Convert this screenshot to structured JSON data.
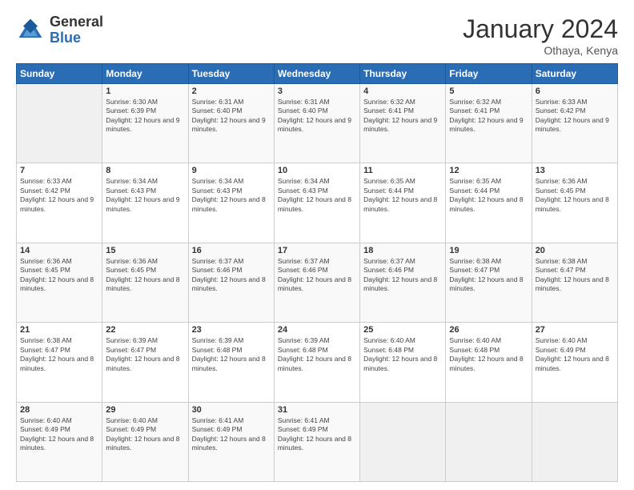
{
  "logo": {
    "general": "General",
    "blue": "Blue"
  },
  "header": {
    "month": "January 2024",
    "location": "Othaya, Kenya"
  },
  "days_of_week": [
    "Sunday",
    "Monday",
    "Tuesday",
    "Wednesday",
    "Thursday",
    "Friday",
    "Saturday"
  ],
  "weeks": [
    [
      {
        "day": "",
        "sunrise": "",
        "sunset": "",
        "daylight": ""
      },
      {
        "day": "1",
        "sunrise": "Sunrise: 6:30 AM",
        "sunset": "Sunset: 6:39 PM",
        "daylight": "Daylight: 12 hours and 9 minutes."
      },
      {
        "day": "2",
        "sunrise": "Sunrise: 6:31 AM",
        "sunset": "Sunset: 6:40 PM",
        "daylight": "Daylight: 12 hours and 9 minutes."
      },
      {
        "day": "3",
        "sunrise": "Sunrise: 6:31 AM",
        "sunset": "Sunset: 6:40 PM",
        "daylight": "Daylight: 12 hours and 9 minutes."
      },
      {
        "day": "4",
        "sunrise": "Sunrise: 6:32 AM",
        "sunset": "Sunset: 6:41 PM",
        "daylight": "Daylight: 12 hours and 9 minutes."
      },
      {
        "day": "5",
        "sunrise": "Sunrise: 6:32 AM",
        "sunset": "Sunset: 6:41 PM",
        "daylight": "Daylight: 12 hours and 9 minutes."
      },
      {
        "day": "6",
        "sunrise": "Sunrise: 6:33 AM",
        "sunset": "Sunset: 6:42 PM",
        "daylight": "Daylight: 12 hours and 9 minutes."
      }
    ],
    [
      {
        "day": "7",
        "sunrise": "Sunrise: 6:33 AM",
        "sunset": "Sunset: 6:42 PM",
        "daylight": "Daylight: 12 hours and 9 minutes."
      },
      {
        "day": "8",
        "sunrise": "Sunrise: 6:34 AM",
        "sunset": "Sunset: 6:43 PM",
        "daylight": "Daylight: 12 hours and 9 minutes."
      },
      {
        "day": "9",
        "sunrise": "Sunrise: 6:34 AM",
        "sunset": "Sunset: 6:43 PM",
        "daylight": "Daylight: 12 hours and 8 minutes."
      },
      {
        "day": "10",
        "sunrise": "Sunrise: 6:34 AM",
        "sunset": "Sunset: 6:43 PM",
        "daylight": "Daylight: 12 hours and 8 minutes."
      },
      {
        "day": "11",
        "sunrise": "Sunrise: 6:35 AM",
        "sunset": "Sunset: 6:44 PM",
        "daylight": "Daylight: 12 hours and 8 minutes."
      },
      {
        "day": "12",
        "sunrise": "Sunrise: 6:35 AM",
        "sunset": "Sunset: 6:44 PM",
        "daylight": "Daylight: 12 hours and 8 minutes."
      },
      {
        "day": "13",
        "sunrise": "Sunrise: 6:36 AM",
        "sunset": "Sunset: 6:45 PM",
        "daylight": "Daylight: 12 hours and 8 minutes."
      }
    ],
    [
      {
        "day": "14",
        "sunrise": "Sunrise: 6:36 AM",
        "sunset": "Sunset: 6:45 PM",
        "daylight": "Daylight: 12 hours and 8 minutes."
      },
      {
        "day": "15",
        "sunrise": "Sunrise: 6:36 AM",
        "sunset": "Sunset: 6:45 PM",
        "daylight": "Daylight: 12 hours and 8 minutes."
      },
      {
        "day": "16",
        "sunrise": "Sunrise: 6:37 AM",
        "sunset": "Sunset: 6:46 PM",
        "daylight": "Daylight: 12 hours and 8 minutes."
      },
      {
        "day": "17",
        "sunrise": "Sunrise: 6:37 AM",
        "sunset": "Sunset: 6:46 PM",
        "daylight": "Daylight: 12 hours and 8 minutes."
      },
      {
        "day": "18",
        "sunrise": "Sunrise: 6:37 AM",
        "sunset": "Sunset: 6:46 PM",
        "daylight": "Daylight: 12 hours and 8 minutes."
      },
      {
        "day": "19",
        "sunrise": "Sunrise: 6:38 AM",
        "sunset": "Sunset: 6:47 PM",
        "daylight": "Daylight: 12 hours and 8 minutes."
      },
      {
        "day": "20",
        "sunrise": "Sunrise: 6:38 AM",
        "sunset": "Sunset: 6:47 PM",
        "daylight": "Daylight: 12 hours and 8 minutes."
      }
    ],
    [
      {
        "day": "21",
        "sunrise": "Sunrise: 6:38 AM",
        "sunset": "Sunset: 6:47 PM",
        "daylight": "Daylight: 12 hours and 8 minutes."
      },
      {
        "day": "22",
        "sunrise": "Sunrise: 6:39 AM",
        "sunset": "Sunset: 6:47 PM",
        "daylight": "Daylight: 12 hours and 8 minutes."
      },
      {
        "day": "23",
        "sunrise": "Sunrise: 6:39 AM",
        "sunset": "Sunset: 6:48 PM",
        "daylight": "Daylight: 12 hours and 8 minutes."
      },
      {
        "day": "24",
        "sunrise": "Sunrise: 6:39 AM",
        "sunset": "Sunset: 6:48 PM",
        "daylight": "Daylight: 12 hours and 8 minutes."
      },
      {
        "day": "25",
        "sunrise": "Sunrise: 6:40 AM",
        "sunset": "Sunset: 6:48 PM",
        "daylight": "Daylight: 12 hours and 8 minutes."
      },
      {
        "day": "26",
        "sunrise": "Sunrise: 6:40 AM",
        "sunset": "Sunset: 6:48 PM",
        "daylight": "Daylight: 12 hours and 8 minutes."
      },
      {
        "day": "27",
        "sunrise": "Sunrise: 6:40 AM",
        "sunset": "Sunset: 6:49 PM",
        "daylight": "Daylight: 12 hours and 8 minutes."
      }
    ],
    [
      {
        "day": "28",
        "sunrise": "Sunrise: 6:40 AM",
        "sunset": "Sunset: 6:49 PM",
        "daylight": "Daylight: 12 hours and 8 minutes."
      },
      {
        "day": "29",
        "sunrise": "Sunrise: 6:40 AM",
        "sunset": "Sunset: 6:49 PM",
        "daylight": "Daylight: 12 hours and 8 minutes."
      },
      {
        "day": "30",
        "sunrise": "Sunrise: 6:41 AM",
        "sunset": "Sunset: 6:49 PM",
        "daylight": "Daylight: 12 hours and 8 minutes."
      },
      {
        "day": "31",
        "sunrise": "Sunrise: 6:41 AM",
        "sunset": "Sunset: 6:49 PM",
        "daylight": "Daylight: 12 hours and 8 minutes."
      },
      {
        "day": "",
        "sunrise": "",
        "sunset": "",
        "daylight": ""
      },
      {
        "day": "",
        "sunrise": "",
        "sunset": "",
        "daylight": ""
      },
      {
        "day": "",
        "sunrise": "",
        "sunset": "",
        "daylight": ""
      }
    ]
  ]
}
